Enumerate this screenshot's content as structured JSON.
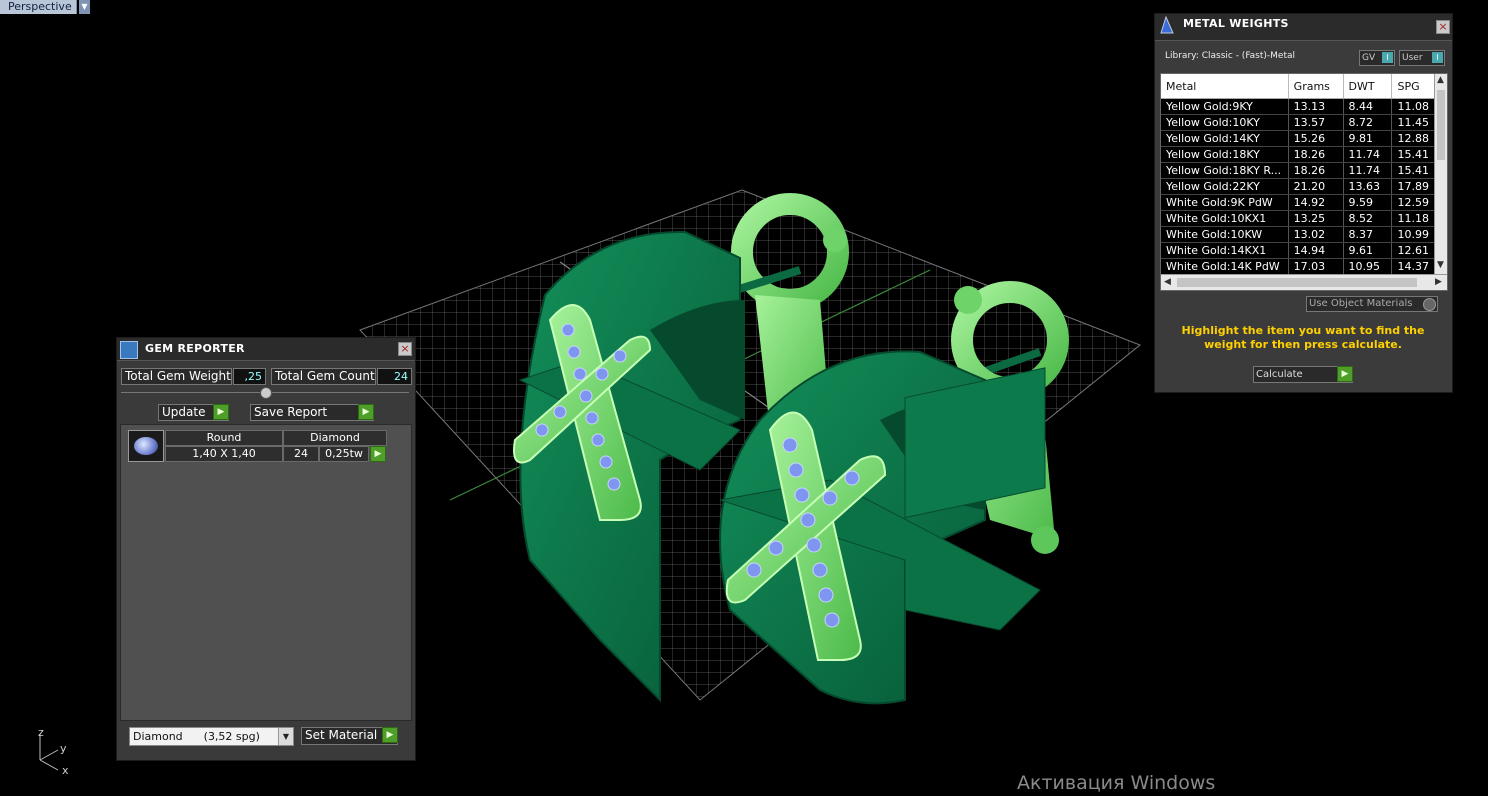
{
  "viewport": {
    "tab_label": "Perspective",
    "tab_menu_icon": "triangle-down",
    "axis_labels": {
      "y": "y",
      "x": "x",
      "z": "z"
    }
  },
  "os_watermark": "Активация Windows",
  "gem_reporter": {
    "title": "GEM REPORTER",
    "total_weight_label": "Total Gem Weight",
    "total_weight_value": ",25",
    "total_count_label": "Total Gem Count",
    "total_count_value": "24",
    "update_label": "Update",
    "save_report_label": "Save Report",
    "gems": [
      {
        "shape": "Round",
        "material": "Diamond",
        "size": "1,40 X 1,40",
        "count": "24",
        "weight": "0,25tw"
      }
    ],
    "material_select": "Diamond      (3,52 spg)",
    "set_material_label": "Set Material"
  },
  "metal_weights": {
    "title": "METAL WEIGHTS",
    "library_text": "Library: Classic - (Fast)-Metal",
    "gv_label": "GV",
    "user_label": "User",
    "columns": [
      "Metal",
      "Grams",
      "DWT",
      "SPG"
    ],
    "rows": [
      [
        "Yellow Gold:9KY",
        "13.13",
        "8.44",
        "11.08"
      ],
      [
        "Yellow Gold:10KY",
        "13.57",
        "8.72",
        "11.45"
      ],
      [
        "Yellow Gold:14KY",
        "15.26",
        "9.81",
        "12.88"
      ],
      [
        "Yellow Gold:18KY",
        "18.26",
        "11.74",
        "15.41"
      ],
      [
        "Yellow Gold:18KY R...",
        "18.26",
        "11.74",
        "15.41"
      ],
      [
        "Yellow Gold:22KY",
        "21.20",
        "13.63",
        "17.89"
      ],
      [
        "White Gold:9K PdW",
        "14.92",
        "9.59",
        "12.59"
      ],
      [
        "White Gold:10KX1",
        "13.25",
        "8.52",
        "11.18"
      ],
      [
        "White Gold:10KW",
        "13.02",
        "8.37",
        "10.99"
      ],
      [
        "White Gold:14KX1",
        "14.94",
        "9.61",
        "12.61"
      ],
      [
        "White Gold:14K PdW",
        "17.03",
        "10.95",
        "14.37"
      ]
    ],
    "use_object_materials_label": "Use Object Materials",
    "hint": "Highlight the item you want to find the weight for then press calculate.",
    "calculate_label": "Calculate"
  },
  "colors": {
    "ring_dark": "#0f7a4e",
    "ring_light": "#7ee07a",
    "gem_blue": "#7f96f0",
    "hint_yellow": "#ffd000",
    "go_green": "#4f9e2a"
  }
}
